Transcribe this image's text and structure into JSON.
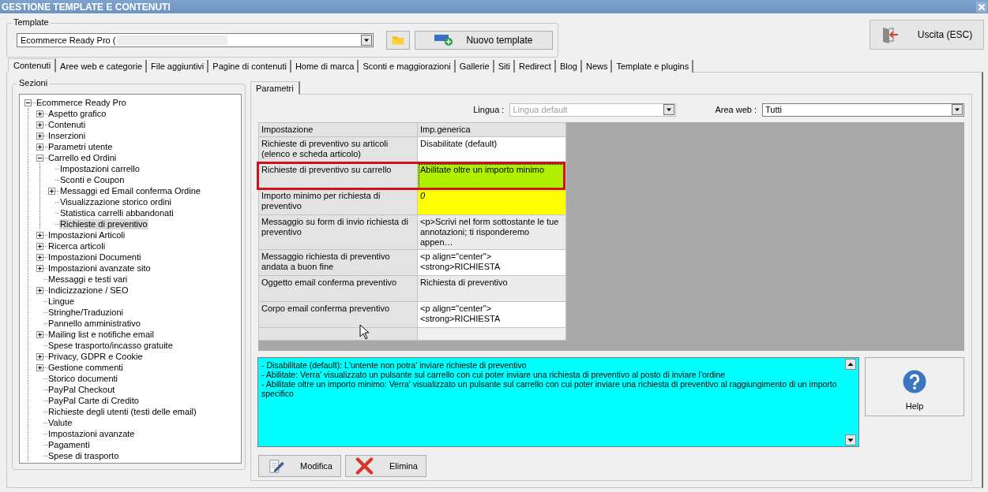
{
  "window": {
    "title": "GESTIONE TEMPLATE E CONTENUTI"
  },
  "template": {
    "label": "Template",
    "value": "Ecommerce Ready Pro (",
    "new_button": "Nuovo template"
  },
  "exit_button": "Uscita (ESC)",
  "tabs": [
    {
      "label": "Contenuti",
      "selected": true
    },
    {
      "label": "Aree web e categorie",
      "selected": false
    },
    {
      "label": "File aggiuntivi",
      "selected": false
    },
    {
      "label": "Pagine di contenuti",
      "selected": false
    },
    {
      "label": "Home di marca",
      "selected": false
    },
    {
      "label": "Sconti e maggiorazioni",
      "selected": false
    },
    {
      "label": "Gallerie",
      "selected": false
    },
    {
      "label": "Siti",
      "selected": false
    },
    {
      "label": "Redirect",
      "selected": false
    },
    {
      "label": "Blog",
      "selected": false
    },
    {
      "label": "News",
      "selected": false
    },
    {
      "label": "Template e plugins",
      "selected": false
    }
  ],
  "sections": {
    "label": "Sezioni",
    "tree": [
      {
        "label": "Ecommerce Ready Pro",
        "kind": "node",
        "expanded": true,
        "selected": false,
        "children": [
          {
            "label": "Aspetto grafico",
            "kind": "node",
            "expanded": false,
            "selected": false
          },
          {
            "label": "Contenuti",
            "kind": "node",
            "expanded": false,
            "selected": false
          },
          {
            "label": "Inserzioni",
            "kind": "node",
            "expanded": false,
            "selected": false
          },
          {
            "label": "Parametri utente",
            "kind": "node",
            "expanded": false,
            "selected": false
          },
          {
            "label": "Carrello ed Ordini",
            "kind": "node",
            "expanded": true,
            "selected": false,
            "children": [
              {
                "label": "Impostazioni carrello",
                "kind": "leaf",
                "selected": false
              },
              {
                "label": "Sconti e Coupon",
                "kind": "leaf",
                "selected": false
              },
              {
                "label": "Messaggi ed Email conferma Ordine",
                "kind": "node",
                "expanded": false,
                "selected": false
              },
              {
                "label": "Visualizzazione storico ordini",
                "kind": "leaf",
                "selected": false
              },
              {
                "label": "Statistica carrelli abbandonati",
                "kind": "leaf",
                "selected": false
              },
              {
                "label": "Richieste di preventivo",
                "kind": "leaf",
                "selected": true
              }
            ]
          },
          {
            "label": "Impostazioni Articoli",
            "kind": "node",
            "expanded": false,
            "selected": false
          },
          {
            "label": "Ricerca articoli",
            "kind": "node",
            "expanded": false,
            "selected": false
          },
          {
            "label": "Impostazioni Documenti",
            "kind": "node",
            "expanded": false,
            "selected": false
          },
          {
            "label": "Impostazioni avanzate sito",
            "kind": "node",
            "expanded": false,
            "selected": false
          },
          {
            "label": "Messaggi e testi vari",
            "kind": "leaf",
            "selected": false
          },
          {
            "label": "Indicizzazione / SEO",
            "kind": "node",
            "expanded": false,
            "selected": false
          },
          {
            "label": "Lingue",
            "kind": "leaf",
            "selected": false
          },
          {
            "label": "Stringhe/Traduzioni",
            "kind": "leaf",
            "selected": false
          },
          {
            "label": "Pannello amministrativo",
            "kind": "leaf",
            "selected": false
          },
          {
            "label": "Mailing list e notifiche email",
            "kind": "node",
            "expanded": false,
            "selected": false
          },
          {
            "label": "Spese trasporto/incasso gratuite",
            "kind": "leaf",
            "selected": false
          },
          {
            "label": "Privacy, GDPR e Cookie",
            "kind": "node",
            "expanded": false,
            "selected": false
          },
          {
            "label": "Gestione commenti",
            "kind": "node",
            "expanded": false,
            "selected": false
          },
          {
            "label": "Storico documenti",
            "kind": "leaf",
            "selected": false
          },
          {
            "label": "PayPal Checkout",
            "kind": "leaf",
            "selected": false
          },
          {
            "label": "PayPal Carte di Credito",
            "kind": "leaf",
            "selected": false
          },
          {
            "label": "Richieste degli utenti (testi delle email)",
            "kind": "leaf",
            "selected": false
          },
          {
            "label": "Valute",
            "kind": "leaf",
            "selected": false
          },
          {
            "label": "Impostazioni avanzate",
            "kind": "leaf",
            "selected": false
          },
          {
            "label": "Pagamenti",
            "kind": "leaf",
            "selected": false
          },
          {
            "label": "Spese di trasporto",
            "kind": "leaf",
            "selected": false
          }
        ]
      }
    ]
  },
  "params": {
    "tabs": [
      {
        "label": "Parametri",
        "selected": true
      }
    ],
    "language": {
      "label": "Lingua :",
      "value": "Lingua default",
      "disabled": true
    },
    "area": {
      "label": "Area web :",
      "value": "Tutti",
      "disabled": false
    },
    "columns": [
      "Impostazione",
      "Imp.generica"
    ],
    "rows": [
      {
        "setting": "Richieste di preventivo su articoli (elenco e scheda articolo)",
        "value": "Disabilitate (default)",
        "color": "#ffffff",
        "selected": false,
        "kind": "text"
      },
      {
        "setting": "Richieste di preventivo su carrello",
        "value": "Abilitate oltre un importo minimo",
        "color": "#aef000",
        "selected": true,
        "kind": "text"
      },
      {
        "setting": "Importo minimo per richiesta di preventivo",
        "value": "0",
        "color": "#ffff00",
        "selected": false,
        "kind": "number"
      },
      {
        "setting": "Messaggio su form di invio richiesta di preventivo",
        "value": "<p>Scrivi nel form sottostante le tue annotazioni; ti risponderemo appen…",
        "color": "#ebebeb",
        "selected": false,
        "kind": "text"
      },
      {
        "setting": "Messaggio richiesta di preventivo andata a buon fine",
        "value": "<p align=\"center\"><strong>RICHIESTA",
        "color": "#ffffff",
        "selected": false,
        "kind": "text"
      },
      {
        "setting": "Oggetto email conferma preventivo",
        "value": "Richiesta di preventivo",
        "color": "#ebebeb",
        "selected": false,
        "kind": "text"
      },
      {
        "setting": "Corpo email conferma preventivo",
        "value": "<p align=\"center\"><strong>RICHIESTA",
        "color": "#ffffff",
        "selected": false,
        "kind": "text"
      }
    ],
    "description": [
      "- Disabilitate (default): L'untente non potra' inviare richieste di preventivo",
      "- Abilitate: Verra' visualizzato un pulsante sul carrello con cui poter inviare una richiesta di preventivo al posto di inviare l'ordine",
      "- Abilitate oltre un importo minimo: Verra' visualizzato un pulsante sul carrello con cui poter inviare una richiesta di preventivo al raggiungimento di un importo specifico"
    ],
    "help_button": "Help",
    "buttons": [
      {
        "label": "Modifica",
        "kind": "edit"
      },
      {
        "label": "Elimina",
        "kind": "delete"
      }
    ]
  }
}
